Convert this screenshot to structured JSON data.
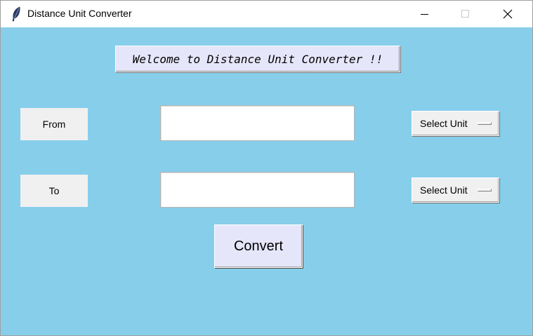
{
  "window": {
    "title": "Distance Unit Converter",
    "app_icon": "feather-icon",
    "controls": [
      "minimize-icon",
      "maximize-icon",
      "close-icon"
    ]
  },
  "banner": {
    "text": "Welcome to Distance Unit Converter !!"
  },
  "from_row": {
    "label": "From",
    "input_value": "",
    "unit_selected": "Select Unit"
  },
  "to_row": {
    "label": "To",
    "input_value": "",
    "unit_selected": "Select Unit"
  },
  "convert_button": {
    "label": "Convert"
  },
  "colors": {
    "background": "#87ceeb",
    "banner": "#e6e6fa",
    "button": "#e6e6fa",
    "label_bg": "#f0f0f0"
  }
}
